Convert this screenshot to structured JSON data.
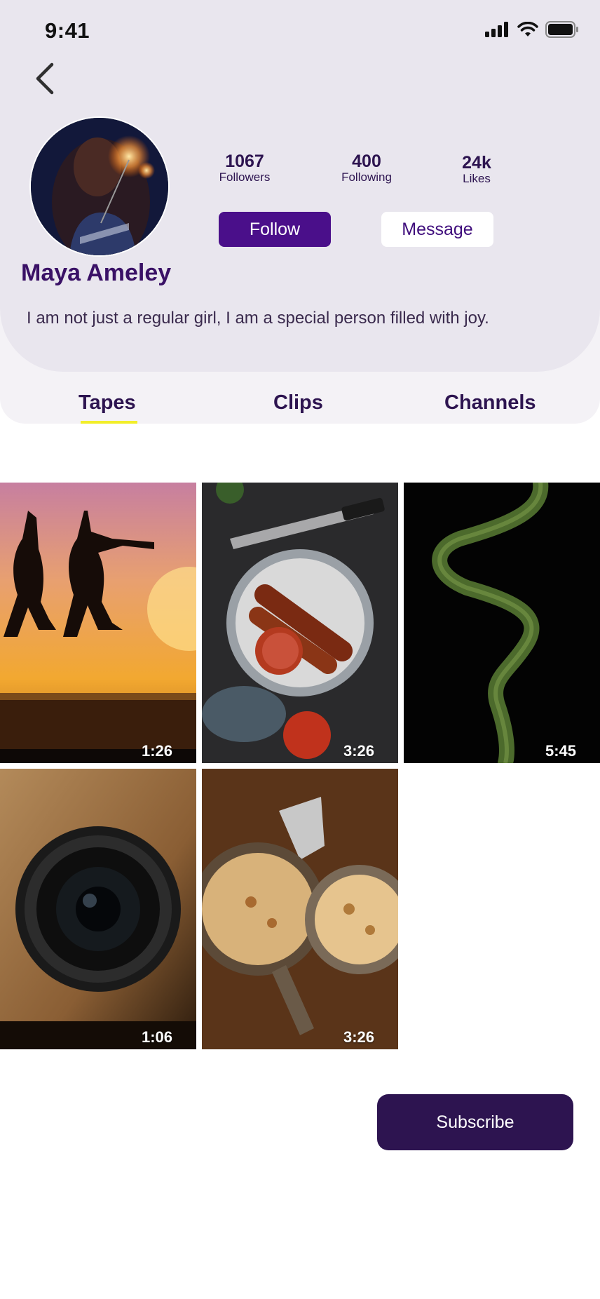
{
  "status_bar": {
    "time": "9:41"
  },
  "profile": {
    "name": "Maya Ameley",
    "bio": "I am not just a regular girl, I am a special person filled with joy.",
    "stats": [
      {
        "value": "1067",
        "label": "Followers"
      },
      {
        "value": "400",
        "label": "Following"
      },
      {
        "value": "24k",
        "label": "Likes"
      }
    ],
    "follow_label": "Follow",
    "message_label": "Message"
  },
  "tabs": [
    {
      "label": "Tapes",
      "active": true
    },
    {
      "label": "Clips",
      "active": false
    },
    {
      "label": "Channels",
      "active": false
    }
  ],
  "videos": [
    {
      "duration": "1:26"
    },
    {
      "duration": "3:26"
    },
    {
      "duration": "5:45"
    },
    {
      "duration": "1:06"
    },
    {
      "duration": "3:26"
    }
  ],
  "subscribe_label": "Subscribe",
  "colors": {
    "primary": "#4a0f8a",
    "dark": "#2d1450",
    "header_bg": "#e9e6ee",
    "tab_underline": "#f2ee2a"
  }
}
